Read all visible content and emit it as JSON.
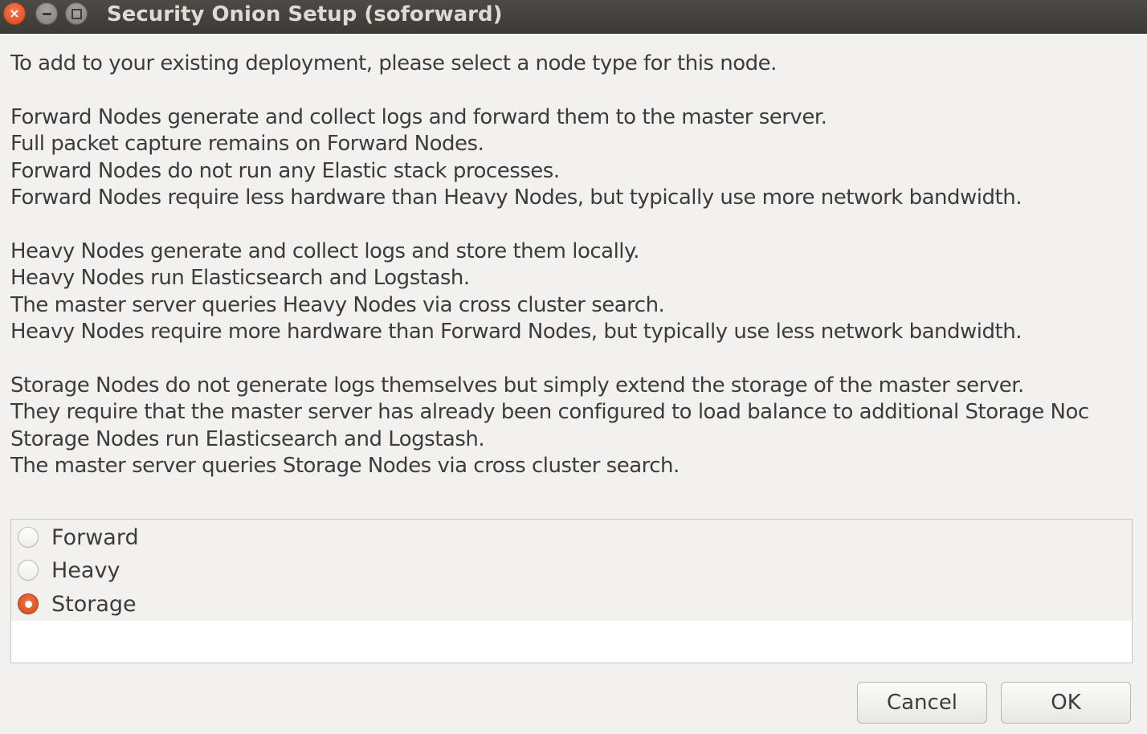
{
  "window": {
    "title": "Security Onion Setup (soforward)",
    "close_glyph": "×",
    "accent_color": "#e05a2b"
  },
  "paragraphs": [
    {
      "lines": [
        "To add to your existing deployment, please select a node type for this node."
      ]
    },
    {
      "lines": [
        "Forward Nodes generate and collect logs and forward them to the master server.",
        "Full packet capture remains on Forward Nodes.",
        "Forward Nodes do not run any Elastic stack processes.",
        "Forward Nodes require less hardware than Heavy Nodes, but typically use more network bandwidth."
      ]
    },
    {
      "lines": [
        "Heavy Nodes generate and collect logs and store them locally.",
        "Heavy Nodes run Elasticsearch and Logstash.",
        "The master server queries Heavy Nodes via cross cluster search.",
        "Heavy Nodes require more hardware than Forward Nodes, but typically use less network bandwidth."
      ]
    },
    {
      "lines": [
        "Storage Nodes do not generate logs themselves but simply extend the storage of the master server.",
        "They require that the master server has already been configured to load balance to additional Storage Noc",
        "Storage Nodes run Elasticsearch and Logstash.",
        "The master server queries Storage Nodes via cross cluster search."
      ]
    }
  ],
  "node_types": {
    "selected": "Storage",
    "options": [
      {
        "label": "Forward",
        "checked": false
      },
      {
        "label": "Heavy",
        "checked": false
      },
      {
        "label": "Storage",
        "checked": true
      }
    ]
  },
  "buttons": {
    "cancel_label": "Cancel",
    "ok_label": "OK"
  }
}
